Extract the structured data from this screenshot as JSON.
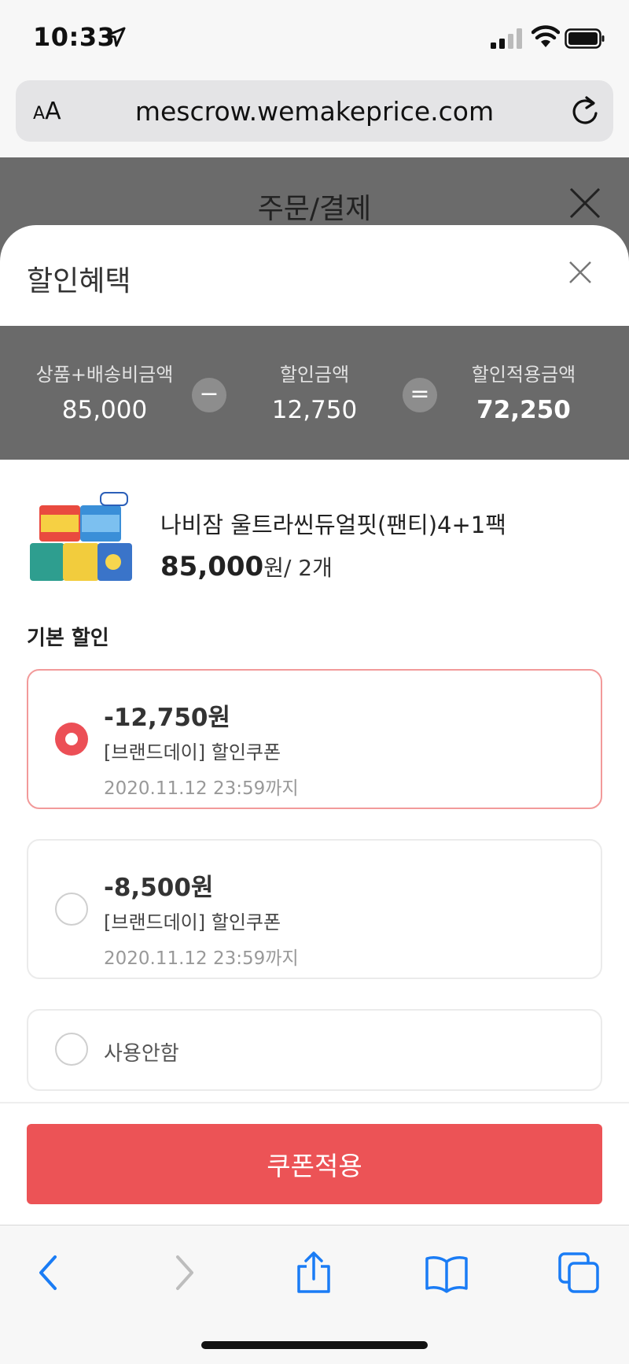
{
  "status_bar": {
    "time": "10:33"
  },
  "url_bar": {
    "aa_small": "A",
    "aa_big": "A",
    "url": "mescrow.wemakeprice.com"
  },
  "background_page": {
    "title": "주문/결제"
  },
  "sheet": {
    "title": "할인혜택",
    "summary": {
      "subtotal_label": "상품+배송비금액",
      "subtotal_value": "85,000",
      "minus_symbol": "−",
      "discount_label": "할인금액",
      "discount_value": "12,750",
      "equals_symbol": "=",
      "final_label": "할인적용금액",
      "final_value": "72,250"
    },
    "product": {
      "name": "나비잠 울트라씬듀얼핏(팬티)4+1팩",
      "price": "85,000",
      "price_unit": "원",
      "quantity": "/ 2개"
    },
    "section_title": "기본 할인",
    "options": [
      {
        "amount": "-12,750원",
        "name": "[브랜드데이] 할인쿠폰",
        "date": "2020.11.12 23:59까지",
        "selected": true
      },
      {
        "amount": "-8,500원",
        "name": "[브랜드데이] 할인쿠폰",
        "date": "2020.11.12 23:59까지",
        "selected": false
      },
      {
        "label": "사용안함",
        "selected": false
      }
    ],
    "apply_button": "쿠폰적용"
  },
  "colors": {
    "accent": "#ec5356",
    "summary_bg": "#6a6a6a",
    "ios_blue": "#1a7cf5"
  },
  "toolbar_icons": [
    "back-icon",
    "forward-icon",
    "share-icon",
    "bookmarks-icon",
    "tabs-icon"
  ]
}
